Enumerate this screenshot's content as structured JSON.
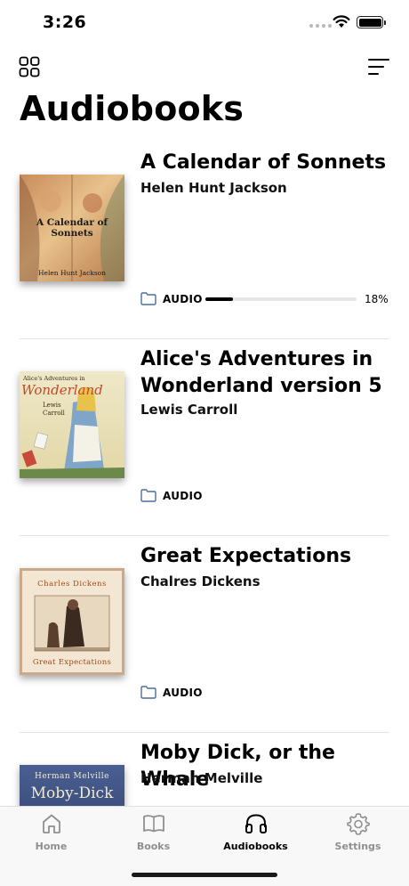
{
  "status_bar": {
    "time": "3:26"
  },
  "header": {
    "title": "Audiobooks"
  },
  "books": [
    {
      "title": "A Calendar of Sonnets",
      "author": "Helen Hunt Jackson",
      "format": "AUDIO",
      "progress_label": "18%",
      "progress": 0.18,
      "cover": {
        "title_text": "A Calendar of Sonnets",
        "author_text": "Helen Hunt Jackson",
        "colors": [
          "#c98b5a",
          "#e8c28c"
        ]
      }
    },
    {
      "title": "Alice's Adventures in Wonderland version 5",
      "author": "Lewis Carroll",
      "format": "AUDIO",
      "cover": {
        "title_text": "Alice's Adventures in",
        "title_big": "Wonderland",
        "author_text": "Lewis Carroll",
        "colors": [
          "#e8e0b8",
          "#7fa6c9"
        ]
      }
    },
    {
      "title": "Great Expectations",
      "author": "Chalres Dickens",
      "format": "AUDIO",
      "cover": {
        "top_text": "Charles Dickens",
        "title_text": "Great Expectations",
        "colors": [
          "#f2e4cf",
          "#b06a3b"
        ]
      }
    },
    {
      "title": "Moby Dick, or the Whale",
      "author": "Herman Melville",
      "format": "AUDIO",
      "cover": {
        "top_text": "Herman Melville",
        "title_text": "Moby-Dick",
        "colors": [
          "#3a4f80",
          "#2b3a62"
        ]
      }
    }
  ],
  "tabs": [
    {
      "label": "Home",
      "icon": "home-icon",
      "active": false
    },
    {
      "label": "Books",
      "icon": "book-icon",
      "active": false
    },
    {
      "label": "Audiobooks",
      "icon": "headphones-icon",
      "active": true
    },
    {
      "label": "Settings",
      "icon": "gear-icon",
      "active": false
    }
  ]
}
